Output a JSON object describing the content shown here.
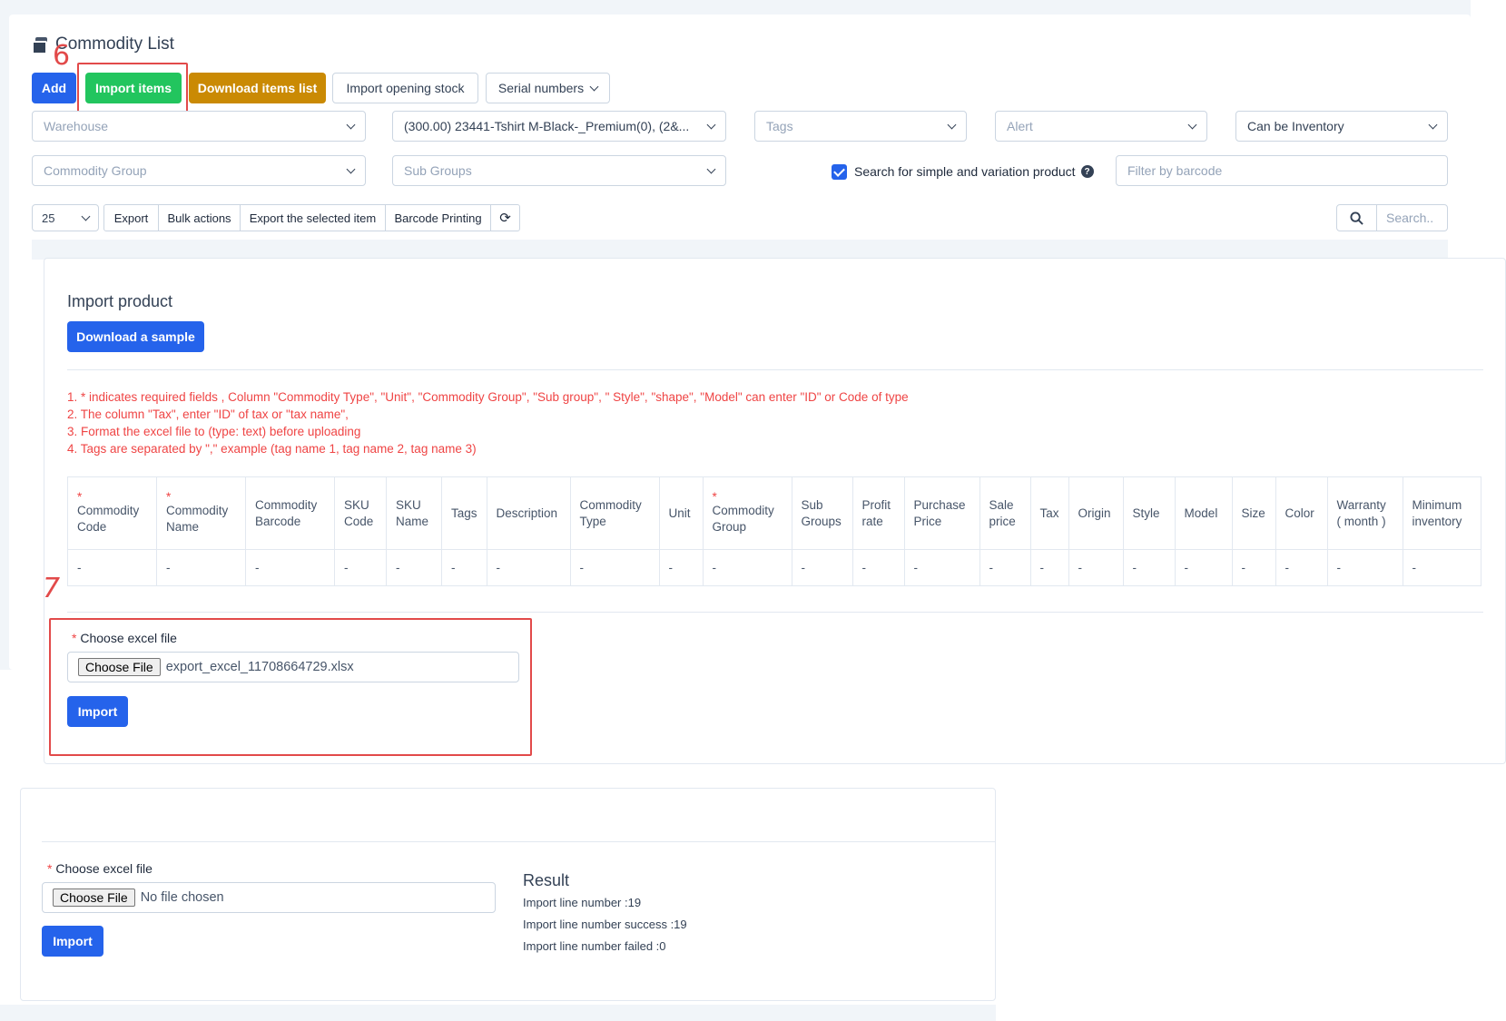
{
  "header": {
    "title": "Commodity List",
    "buttons": {
      "add": "Add",
      "import_items": "Import items",
      "download_items_list": "Download items list",
      "import_opening_stock": "Import opening stock",
      "serial_numbers": "Serial numbers"
    }
  },
  "filters": {
    "warehouse": "Warehouse",
    "item": "(300.00) 23441-Tshirt M-Black-_Premium(0), (2&...",
    "tags": "Tags",
    "alert": "Alert",
    "can_be_inventory": "Can be Inventory",
    "commodity_group": "Commodity Group",
    "sub_groups": "Sub Groups",
    "search_variation_label": "Search for simple and variation product",
    "barcode_placeholder": "Filter by barcode"
  },
  "toolbar": {
    "page_size": "25",
    "export": "Export",
    "bulk_actions": "Bulk actions",
    "export_selected": "Export the selected item",
    "barcode_printing": "Barcode Printing",
    "search_placeholder": "Search.."
  },
  "annotations": {
    "step6": "6",
    "step7": "7"
  },
  "import_panel": {
    "title": "Import product",
    "download_sample": "Download a sample",
    "notes": [
      "1. * indicates required fields , Column \"Commodity Type\", \"Unit\", \"Commodity Group\", \"Sub group\", \" Style\", \"shape\", \"Model\" can enter \"ID\" or Code of type",
      "2. The column \"Tax\", enter \"ID\" of tax or \"tax name\",",
      "3. Format the excel file to (type: text) before uploading",
      "4. Tags are separated by \",\" example (tag name 1, tag name 2, tag name 3)"
    ],
    "columns": [
      {
        "label": "Commodity Code",
        "required": true
      },
      {
        "label": "Commodity Name",
        "required": true
      },
      {
        "label": "Commodity Barcode",
        "required": false
      },
      {
        "label": "SKU Code",
        "required": false
      },
      {
        "label": "SKU Name",
        "required": false
      },
      {
        "label": "Tags",
        "required": false
      },
      {
        "label": "Description",
        "required": false
      },
      {
        "label": "Commodity Type",
        "required": false
      },
      {
        "label": "Unit",
        "required": false
      },
      {
        "label": "Commodity Group",
        "required": true
      },
      {
        "label": "Sub Groups",
        "required": false
      },
      {
        "label": "Profit rate",
        "required": false
      },
      {
        "label": "Purchase Price",
        "required": false
      },
      {
        "label": "Sale price",
        "required": false
      },
      {
        "label": "Tax",
        "required": false
      },
      {
        "label": "Origin",
        "required": false
      },
      {
        "label": "Style",
        "required": false
      },
      {
        "label": "Model",
        "required": false
      },
      {
        "label": "Size",
        "required": false
      },
      {
        "label": "Color",
        "required": false
      },
      {
        "label": "Warranty ( month )",
        "required": false
      },
      {
        "label": "Minimum inventory",
        "required": false
      }
    ],
    "row_placeholder": "-",
    "choose_file_label": "Choose excel file",
    "required_mark": "*",
    "choose_file_button": "Choose File",
    "file_name": "export_excel_11708664729.xlsx",
    "import_button": "Import"
  },
  "result_panel": {
    "choose_file_label": "Choose excel file",
    "required_mark": "*",
    "choose_file_button": "Choose File",
    "file_name": "No file chosen",
    "import_button": "Import",
    "result_title": "Result",
    "lines": [
      "Import line number :19",
      "Import line number success :19",
      "Import line number failed :0"
    ]
  },
  "colors": {
    "primary": "#2563eb",
    "success": "#22c55e",
    "warning": "#ca8a04",
    "danger": "#ef4444",
    "annotation": "#e24a4a"
  }
}
